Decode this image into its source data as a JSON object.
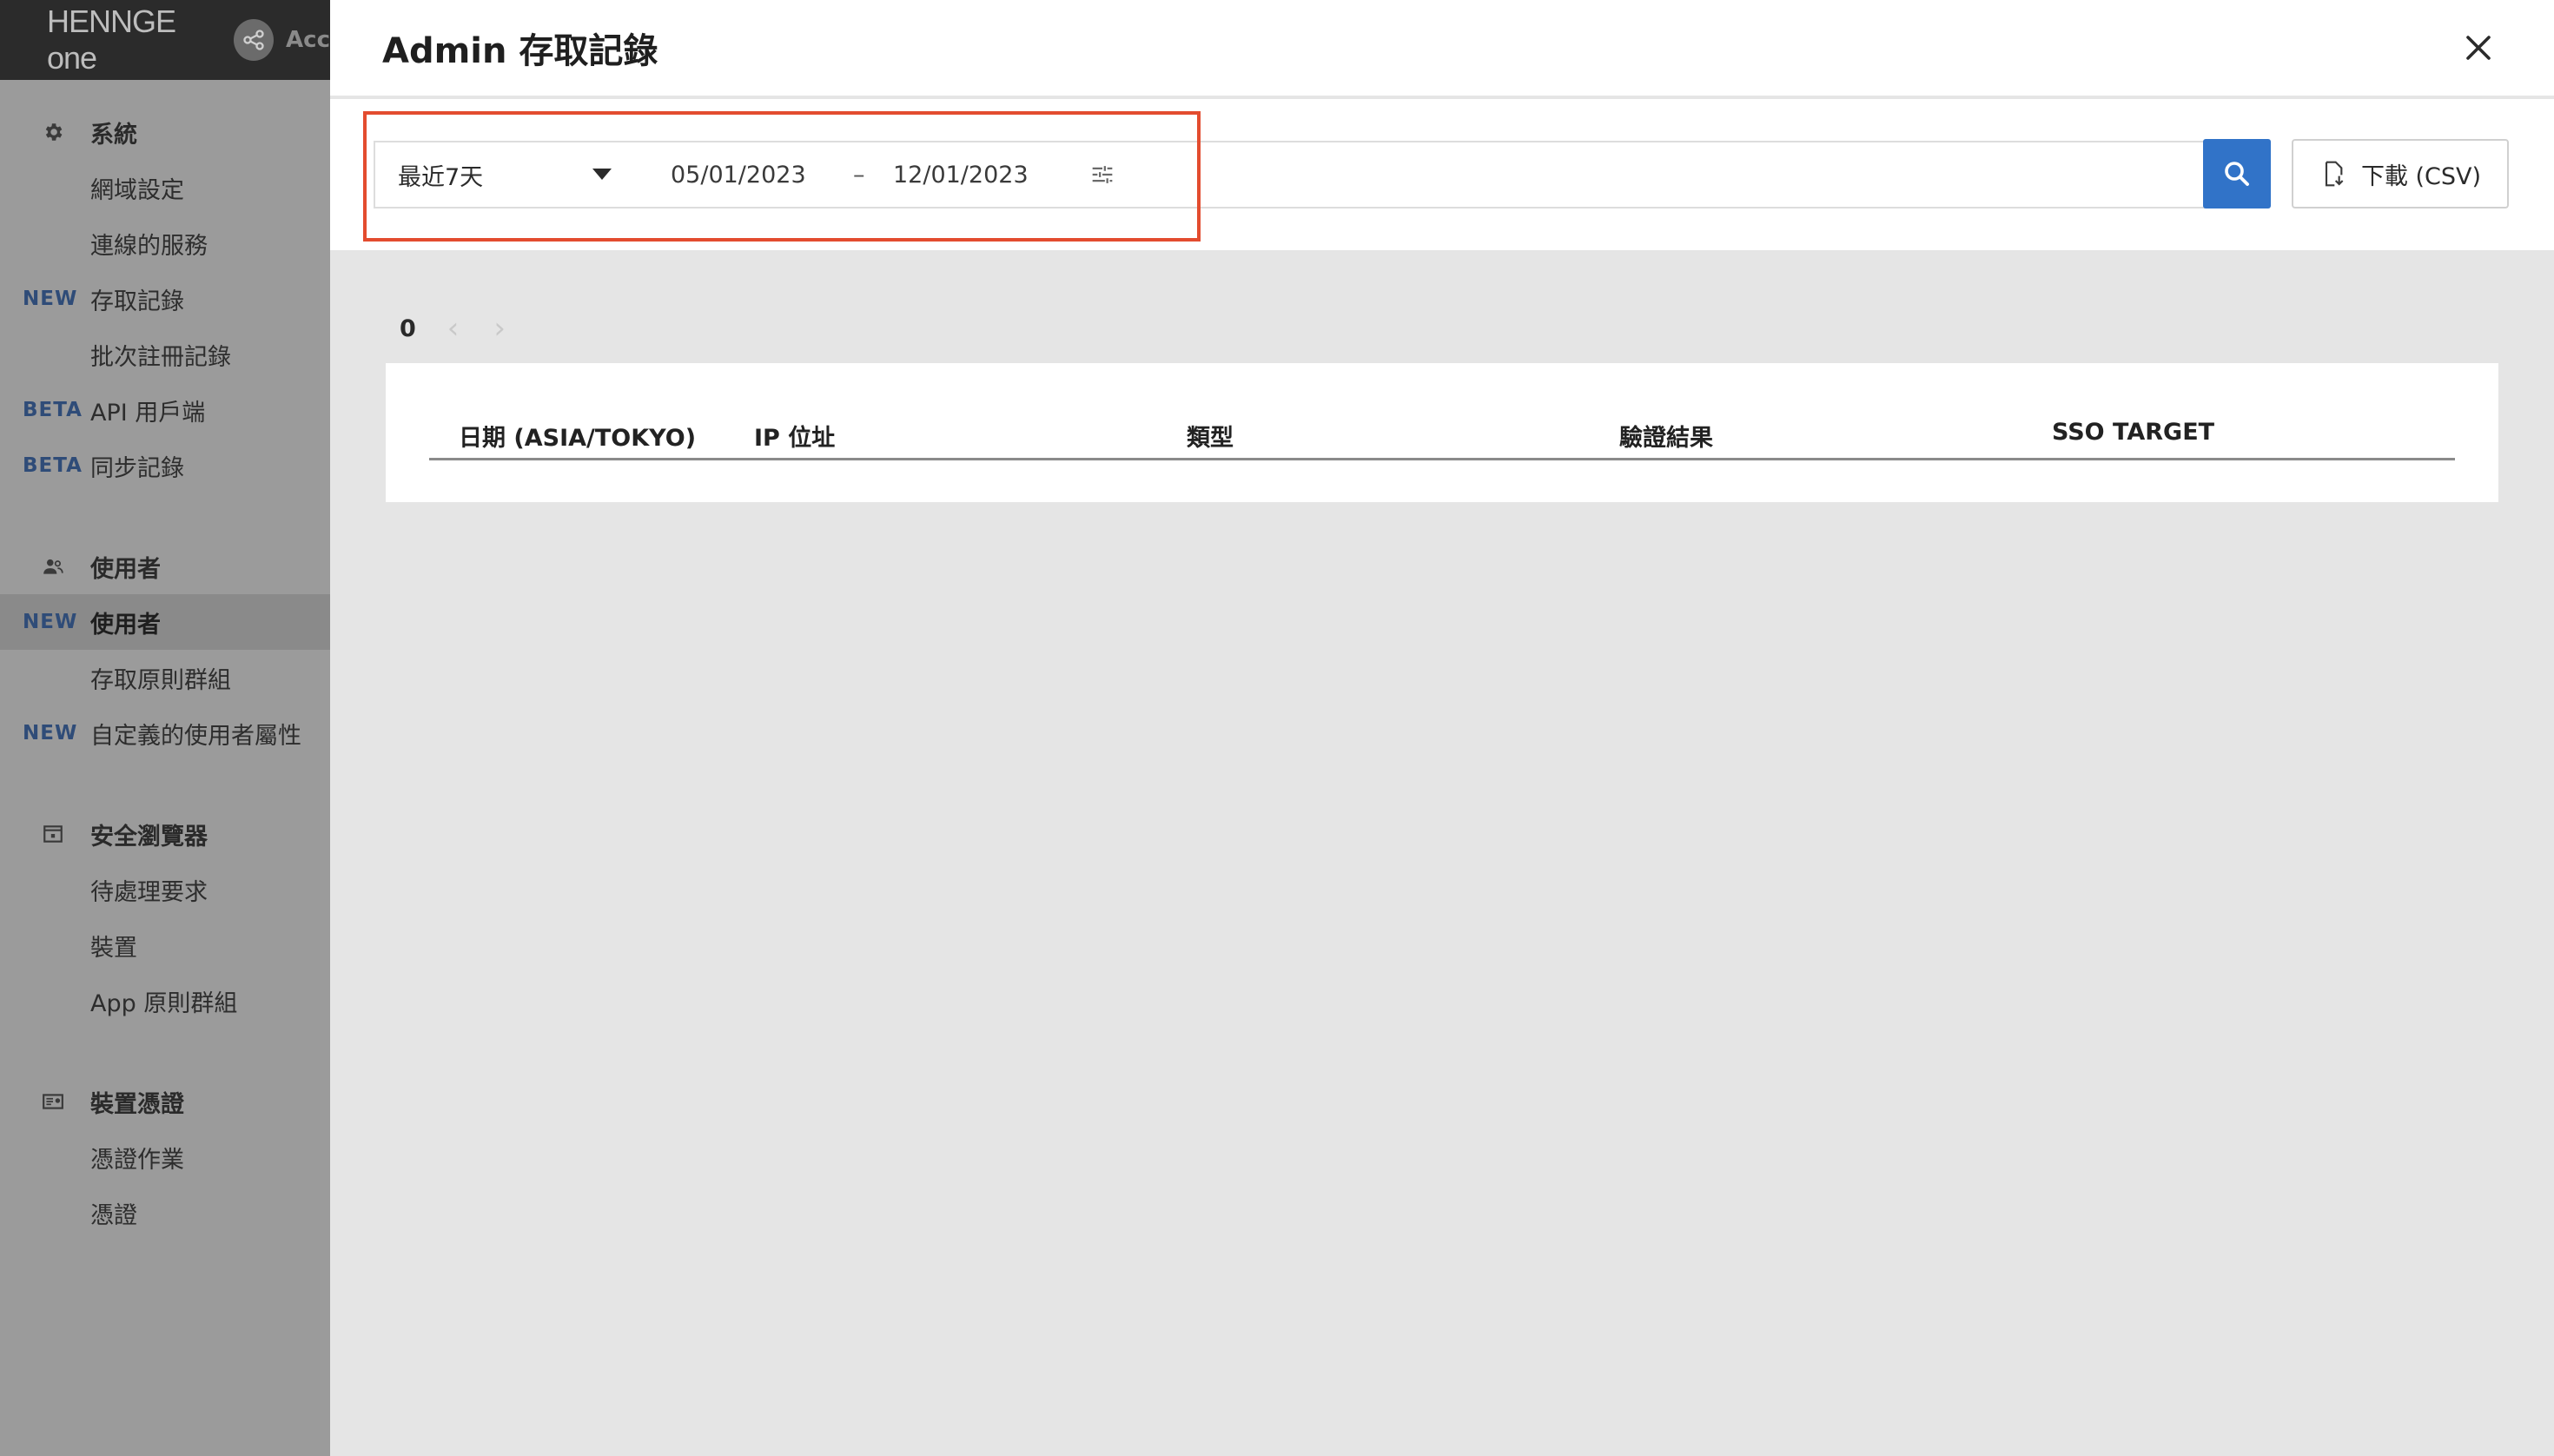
{
  "brand": {
    "name": "HENNGE one",
    "extra": "Acc"
  },
  "sidebar": {
    "groups": [
      {
        "icon": "gear-icon",
        "label": "系統",
        "items": [
          {
            "tag": "",
            "label": "網域設定"
          },
          {
            "tag": "",
            "label": "連線的服務"
          },
          {
            "tag": "NEW",
            "label": "存取記錄"
          },
          {
            "tag": "",
            "label": "批次註冊記錄"
          },
          {
            "tag": "BETA",
            "label": "API 用戶端"
          },
          {
            "tag": "BETA",
            "label": "同步記錄"
          }
        ]
      },
      {
        "icon": "users-icon",
        "label": "使用者",
        "items": [
          {
            "tag": "NEW",
            "label": "使用者",
            "active": true
          },
          {
            "tag": "",
            "label": "存取原則群組"
          },
          {
            "tag": "NEW",
            "label": "自定義的使用者屬性"
          }
        ]
      },
      {
        "icon": "secure-browser-icon",
        "label": "安全瀏覽器",
        "items": [
          {
            "tag": "",
            "label": "待處理要求"
          },
          {
            "tag": "",
            "label": "裝置"
          },
          {
            "tag": "",
            "label": "App 原則群組"
          }
        ]
      },
      {
        "icon": "device-certificate-icon",
        "label": "裝置憑證",
        "items": [
          {
            "tag": "",
            "label": "憑證作業"
          },
          {
            "tag": "",
            "label": "憑證"
          }
        ]
      }
    ]
  },
  "panel": {
    "title": "Admin 存取記錄",
    "filter": {
      "range_value": "最近7天",
      "date_from": "05/01/2023",
      "date_separator": "–",
      "date_to": "12/01/2023"
    },
    "download_label": "下載 (CSV)",
    "pager": {
      "count": "0",
      "prev": "‹",
      "next": "›"
    },
    "table": {
      "columns": [
        "日期 (ASIA/TOKYO)",
        "IP 位址",
        "類型",
        "驗證結果",
        "SSO TARGET"
      ]
    }
  },
  "colors": {
    "accent": "#3173c8",
    "highlight": "#e34c2f",
    "tag": "#2f4c78",
    "overlay_sidebar": "#9b9b9b"
  }
}
